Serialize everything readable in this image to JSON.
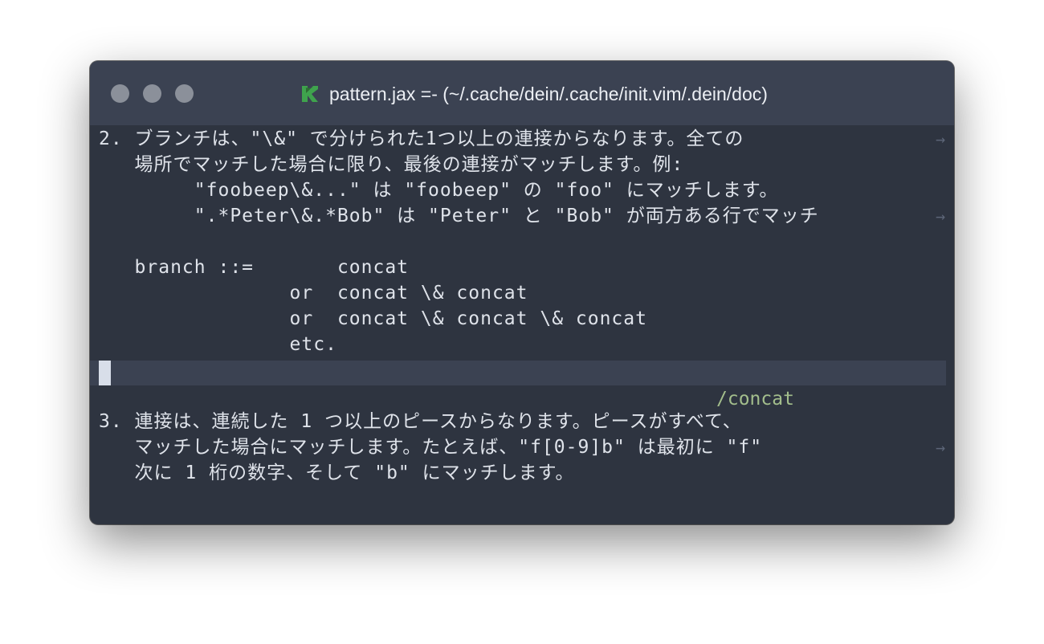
{
  "window": {
    "title": "pattern.jax =- (~/.cache/dein/.cache/init.vim/.dein/doc)",
    "app_icon": "vim-icon",
    "colors": {
      "background": "#2e3440",
      "titlebar": "#3b4252",
      "text": "#dfe3ea",
      "tag": "#a3be8c",
      "icon_green": "#3fa34d"
    }
  },
  "editor": {
    "lines": [
      "2. ブランチは、\"\\&\" で分けられた1つ以上の連接からなります。全ての",
      "   場所でマッチした場合に限り、最後の連接がマッチします。例:",
      "        \"foobeep\\&...\" は \"foobeep\" の \"foo\" にマッチします。",
      "        \".*Peter\\&.*Bob\" は \"Peter\" と \"Bob\" が両方ある行でマッチ",
      "",
      "   branch ::=       concat",
      "                or  concat \\& concat",
      "                or  concat \\& concat \\& concat",
      "                etc.",
      "",
      "",
      "3. 連接は、連続した 1 つ以上のピースからなります。ピースがすべて、",
      "   マッチした場合にマッチします。たとえば、\"f[0-9]b\" は最初に \"f\"",
      "   次に 1 桁の数字、そして \"b\" にマッチします。"
    ],
    "tag": "/concat",
    "wrap_marker": "→"
  }
}
